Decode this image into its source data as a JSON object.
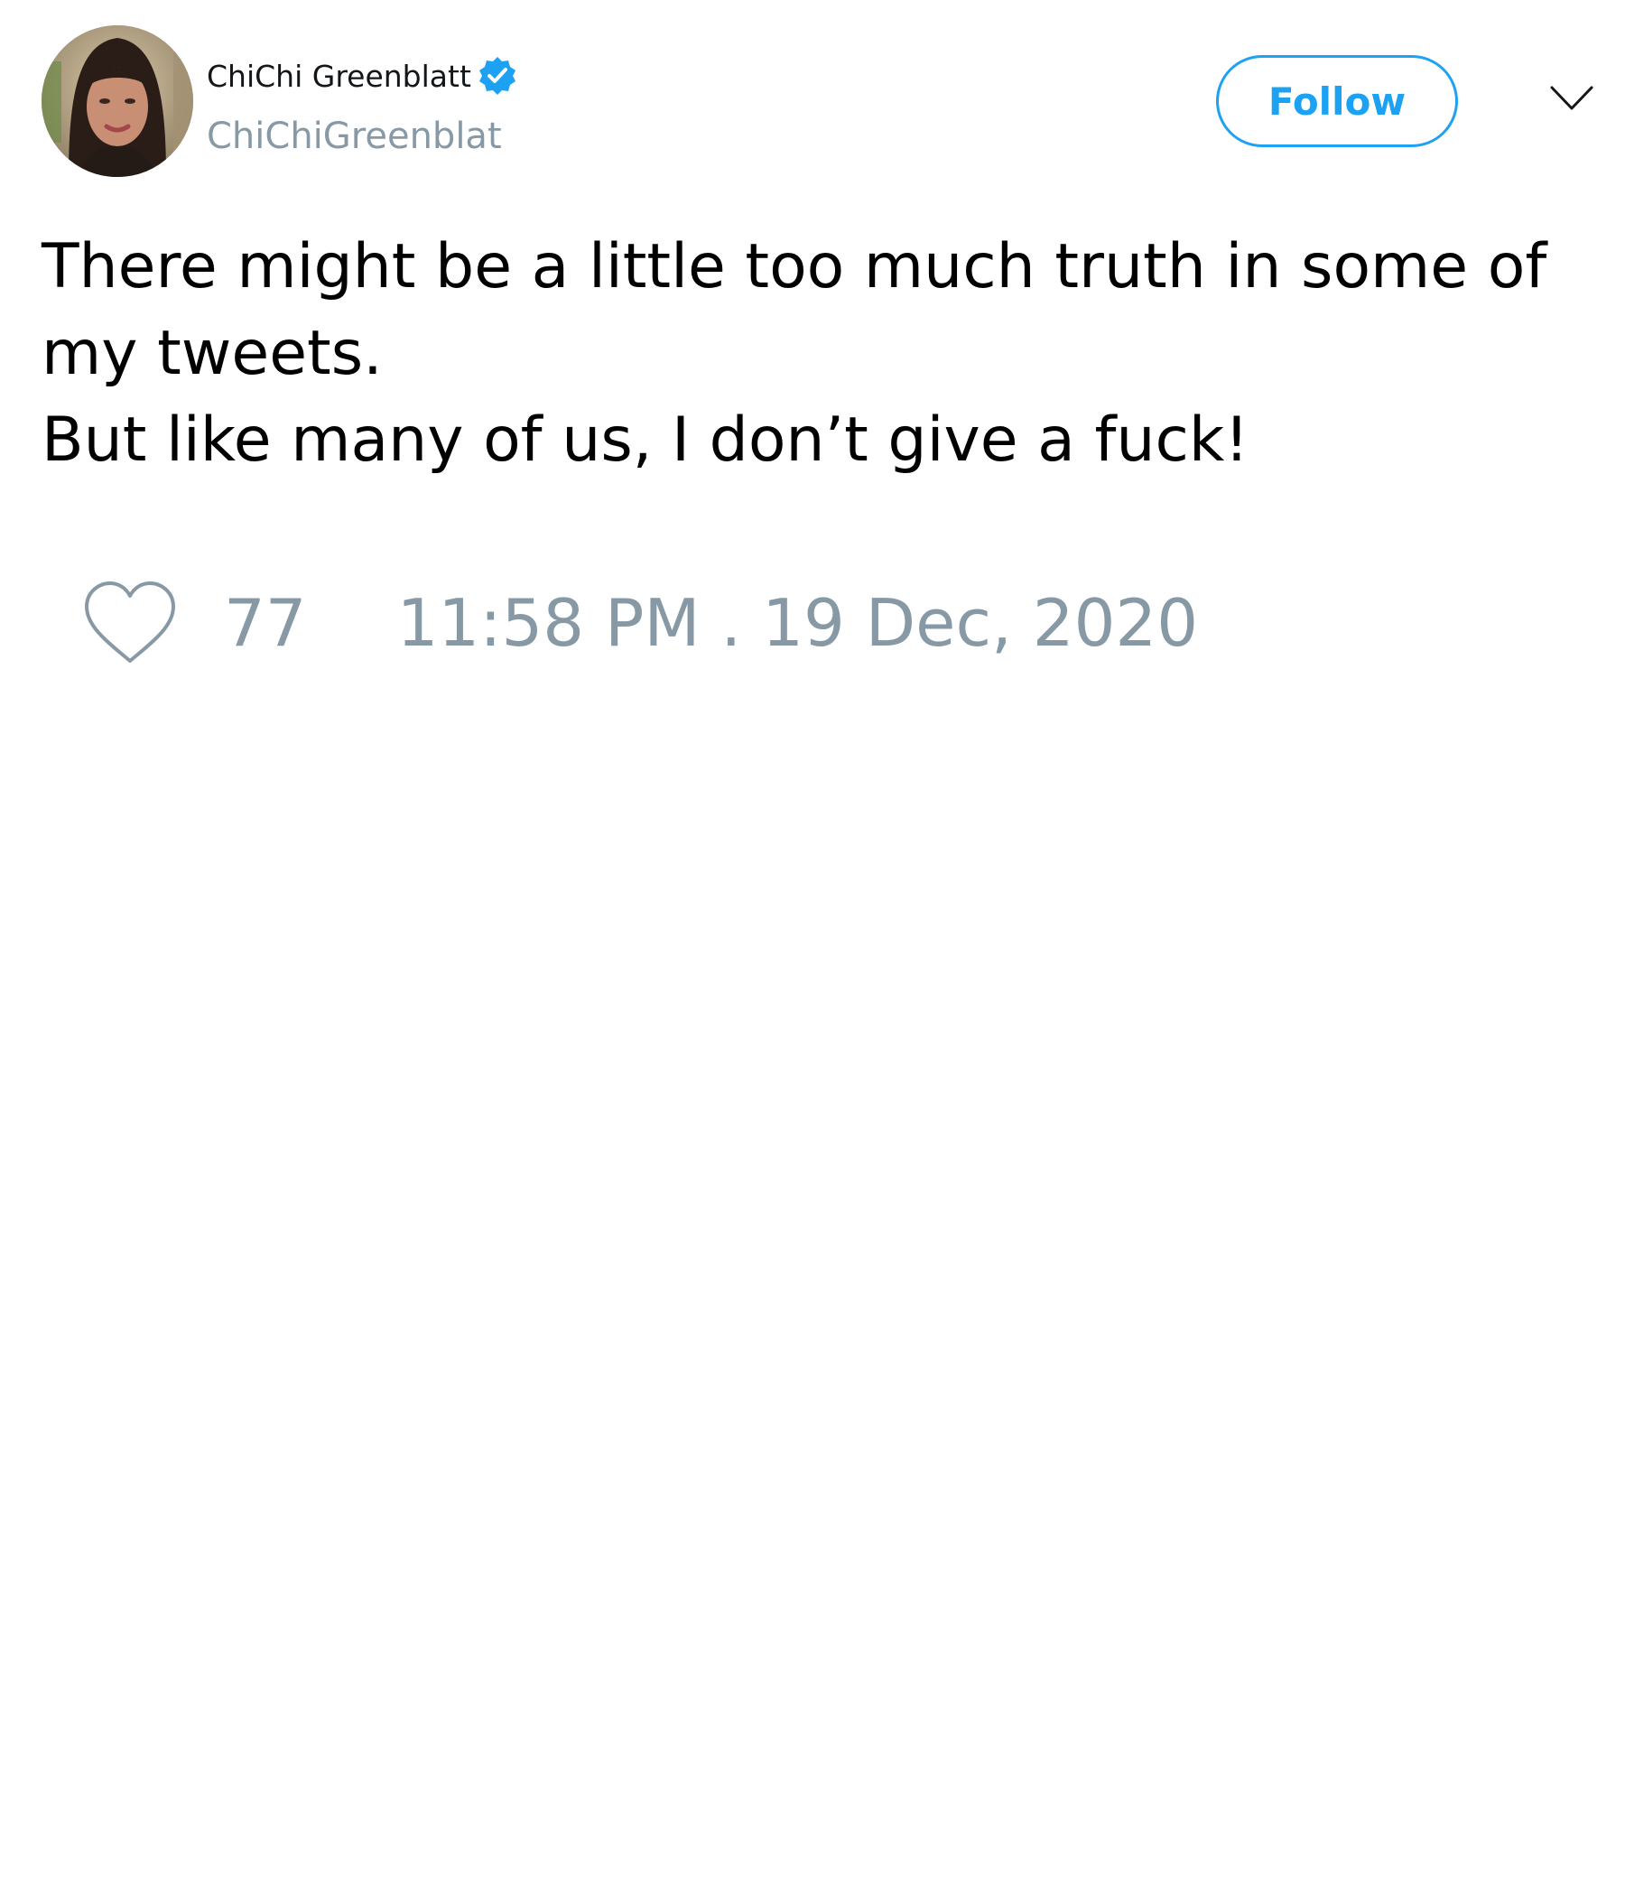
{
  "author": {
    "display_name": "ChiChi Greenblatt",
    "handle": "ChiChiGreenblat",
    "verified": true,
    "avatar_icon": "profile-photo"
  },
  "actions": {
    "follow_label": "Follow",
    "menu_icon": "chevron-down-icon"
  },
  "tweet": {
    "lines": [
      "There might be a little too much truth in some of",
      "my tweets.",
      "But like many of us, I don’t give a fuck!"
    ]
  },
  "footer": {
    "like_icon": "heart-icon",
    "like_count": "77",
    "timestamp": "11:58 PM . 19 Dec, 2020"
  },
  "colors": {
    "accent": "#1da1f2",
    "muted": "#8899a6",
    "text": "#000000",
    "background": "#ffffff"
  }
}
